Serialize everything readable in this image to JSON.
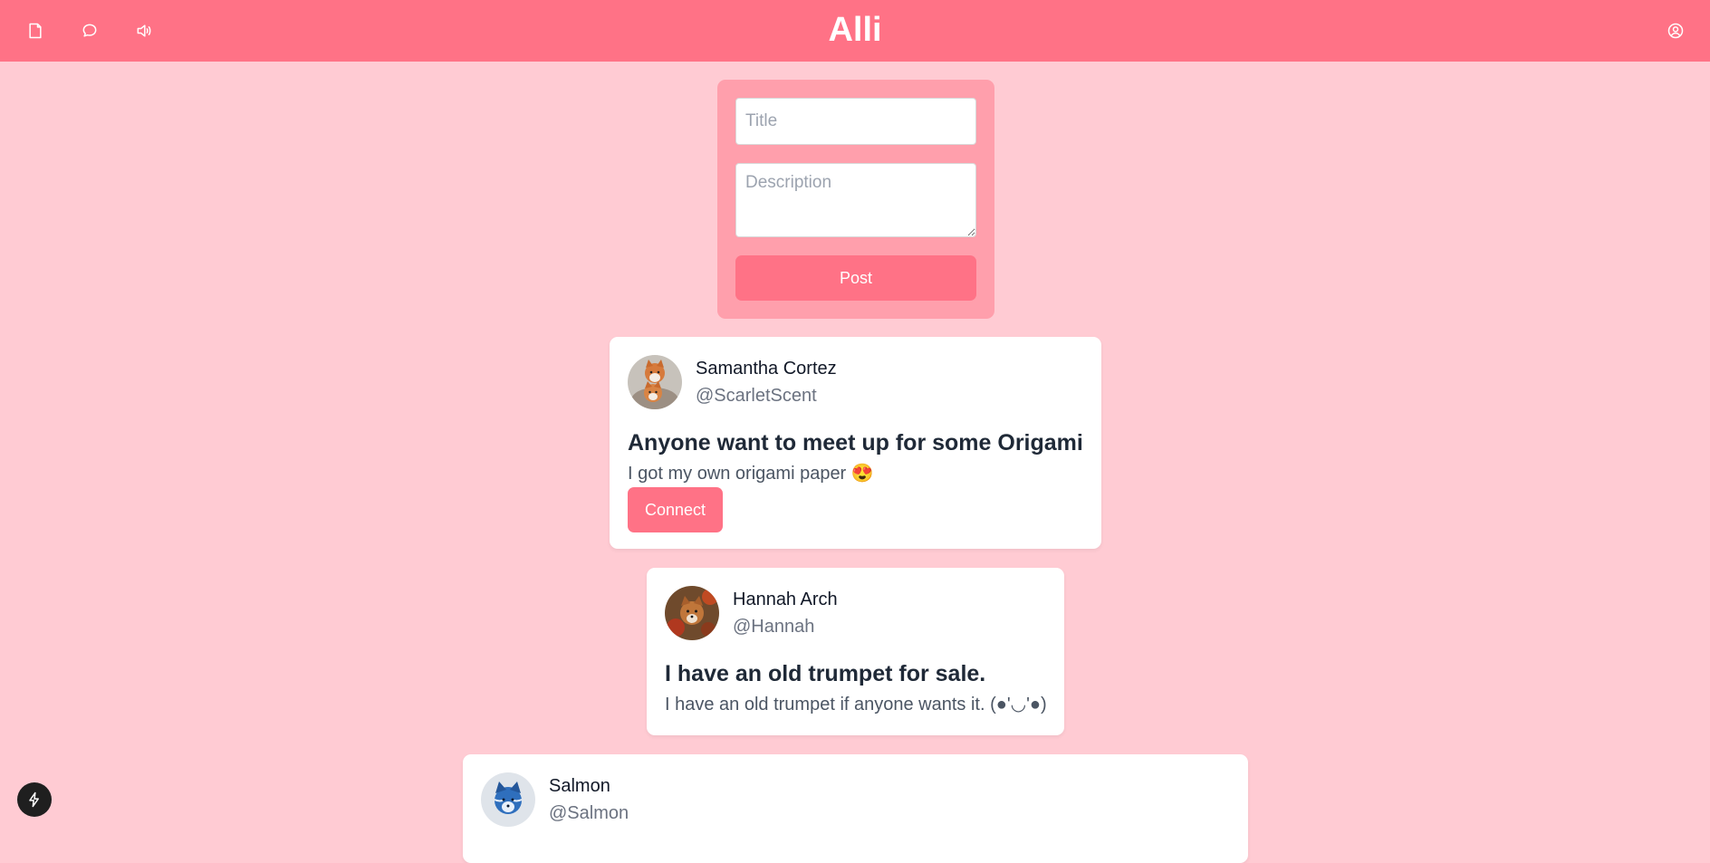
{
  "app": {
    "title": "Alli"
  },
  "header": {
    "icons": [
      "file-icon",
      "message-icon",
      "speaker-icon",
      "user-circle-icon"
    ]
  },
  "composer": {
    "title_placeholder": "Title",
    "title_value": "",
    "description_placeholder": "Description",
    "description_value": "",
    "post_label": "Post"
  },
  "posts": [
    {
      "name": "Samantha Cortez",
      "handle": "@ScarletScent",
      "title": "Anyone want to meet up for some Origami",
      "description": "I got my own origami paper 😍",
      "action_label": "Connect"
    },
    {
      "name": "Hannah Arch",
      "handle": "@Hannah",
      "title": "I have an old trumpet for sale.",
      "description": "I have an old trumpet if anyone wants it. (●'◡'●)"
    },
    {
      "name": "Salmon",
      "handle": "@Salmon"
    }
  ],
  "colors": {
    "header": "#ff7286",
    "page_background": "#ffcbd3",
    "composer_background": "#ff9fac",
    "button": "#ff7286"
  },
  "floating_button": {
    "icon": "lightning-icon"
  }
}
